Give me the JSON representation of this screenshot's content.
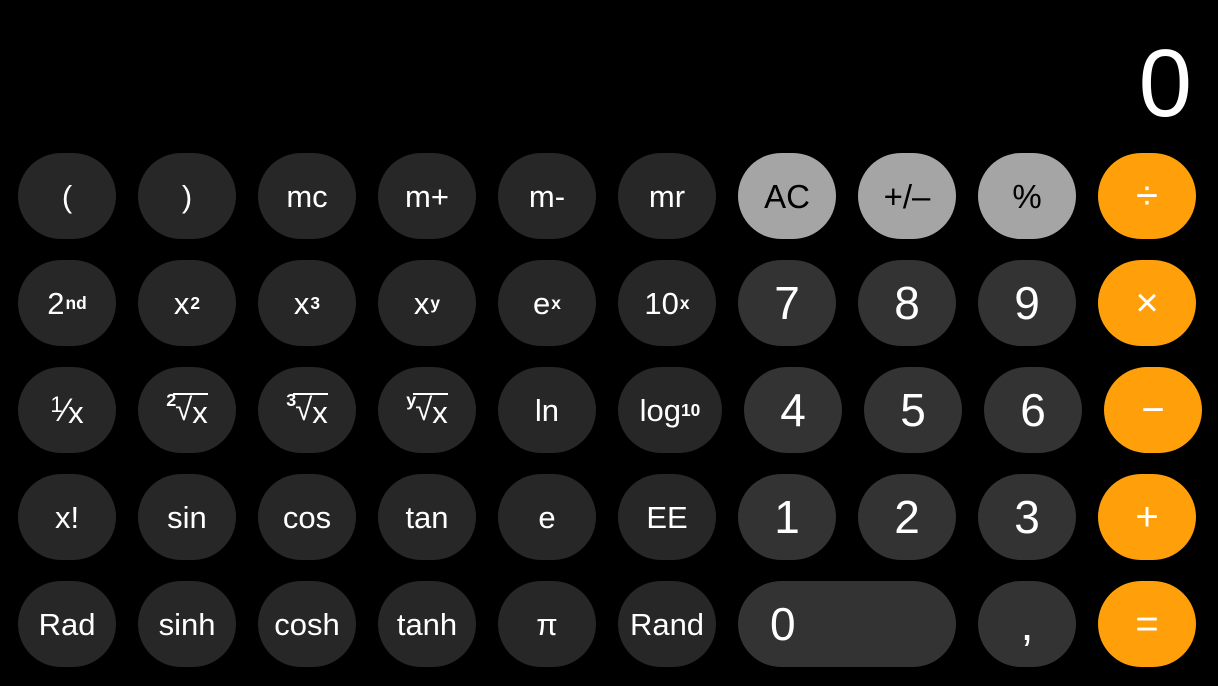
{
  "app": {
    "name": "Calculator",
    "mode": "scientific",
    "background_color": "#000000"
  },
  "display": {
    "value": "0",
    "text_color": "#ffffff"
  },
  "colors": {
    "function_key": "#272727",
    "digit_key": "#333333",
    "utility_key": "#a5a5a5",
    "operator_key": "#ff9f0a",
    "label_light": "#ffffff",
    "label_dark": "#000000"
  },
  "keypad": {
    "rows": [
      {
        "index": 0,
        "keys": [
          {
            "name": "open-paren",
            "label": "(",
            "style": "fn"
          },
          {
            "name": "close-paren",
            "label": ")",
            "style": "fn"
          },
          {
            "name": "memory-clear",
            "label": "mc",
            "style": "fn"
          },
          {
            "name": "memory-add",
            "label": "m+",
            "style": "fn"
          },
          {
            "name": "memory-subtract",
            "label": "m-",
            "style": "fn"
          },
          {
            "name": "memory-recall",
            "label": "mr",
            "style": "fn"
          },
          {
            "name": "all-clear",
            "label": "AC",
            "style": "util"
          },
          {
            "name": "sign-toggle",
            "label": "+/–",
            "style": "util"
          },
          {
            "name": "percent",
            "label": "%",
            "style": "util"
          },
          {
            "name": "divide",
            "label": "÷",
            "style": "op"
          }
        ]
      },
      {
        "index": 1,
        "keys": [
          {
            "name": "second-function",
            "label": "2nd",
            "style": "fn",
            "sup": "nd",
            "base": "2"
          },
          {
            "name": "square",
            "label": "x2",
            "style": "fn",
            "sup": "2",
            "base": "x"
          },
          {
            "name": "cube",
            "label": "x3",
            "style": "fn",
            "sup": "3",
            "base": "x"
          },
          {
            "name": "power-xy",
            "label": "xy",
            "style": "fn",
            "sup": "y",
            "base": "x"
          },
          {
            "name": "exp-e",
            "label": "ex",
            "style": "fn",
            "sup": "x",
            "base": "e"
          },
          {
            "name": "exp-ten",
            "label": "10x",
            "style": "fn",
            "sup": "x",
            "base": "10"
          },
          {
            "name": "digit-7",
            "label": "7",
            "style": "digit"
          },
          {
            "name": "digit-8",
            "label": "8",
            "style": "digit"
          },
          {
            "name": "digit-9",
            "label": "9",
            "style": "digit"
          },
          {
            "name": "multiply",
            "label": "×",
            "style": "op"
          }
        ]
      },
      {
        "index": 2,
        "keys": [
          {
            "name": "reciprocal",
            "label": "1/x",
            "style": "fn"
          },
          {
            "name": "square-root",
            "label": "2√x",
            "style": "fn",
            "radical_index": "2"
          },
          {
            "name": "cube-root",
            "label": "3√x",
            "style": "fn",
            "radical_index": "3"
          },
          {
            "name": "nth-root",
            "label": "y√x",
            "style": "fn",
            "radical_index": "y"
          },
          {
            "name": "natural-log",
            "label": "ln",
            "style": "fn"
          },
          {
            "name": "log-base-10",
            "label": "log10",
            "style": "fn",
            "base": "log",
            "sub": "10"
          },
          {
            "name": "digit-4",
            "label": "4",
            "style": "digit"
          },
          {
            "name": "digit-5",
            "label": "5",
            "style": "digit"
          },
          {
            "name": "digit-6",
            "label": "6",
            "style": "digit"
          },
          {
            "name": "subtract",
            "label": "−",
            "style": "op"
          }
        ]
      },
      {
        "index": 3,
        "keys": [
          {
            "name": "factorial",
            "label": "x!",
            "style": "fn"
          },
          {
            "name": "sine",
            "label": "sin",
            "style": "fn"
          },
          {
            "name": "cosine",
            "label": "cos",
            "style": "fn"
          },
          {
            "name": "tangent",
            "label": "tan",
            "style": "fn"
          },
          {
            "name": "euler-constant",
            "label": "e",
            "style": "fn"
          },
          {
            "name": "scientific-notation",
            "label": "EE",
            "style": "fn"
          },
          {
            "name": "digit-1",
            "label": "1",
            "style": "digit"
          },
          {
            "name": "digit-2",
            "label": "2",
            "style": "digit"
          },
          {
            "name": "digit-3",
            "label": "3",
            "style": "digit"
          },
          {
            "name": "add",
            "label": "+",
            "style": "op"
          }
        ]
      },
      {
        "index": 4,
        "keys": [
          {
            "name": "radian-mode",
            "label": "Rad",
            "style": "fn"
          },
          {
            "name": "hyperbolic-sine",
            "label": "sinh",
            "style": "fn"
          },
          {
            "name": "hyperbolic-cosine",
            "label": "cosh",
            "style": "fn"
          },
          {
            "name": "hyperbolic-tangent",
            "label": "tanh",
            "style": "fn"
          },
          {
            "name": "pi-constant",
            "label": "π",
            "style": "fn"
          },
          {
            "name": "random-number",
            "label": "Rand",
            "style": "fn"
          },
          {
            "name": "digit-0",
            "label": "0",
            "style": "digit",
            "wide": true
          },
          {
            "name": "decimal-separator",
            "label": ",",
            "style": "digit"
          },
          {
            "name": "equals",
            "label": "=",
            "style": "op"
          }
        ]
      }
    ]
  }
}
